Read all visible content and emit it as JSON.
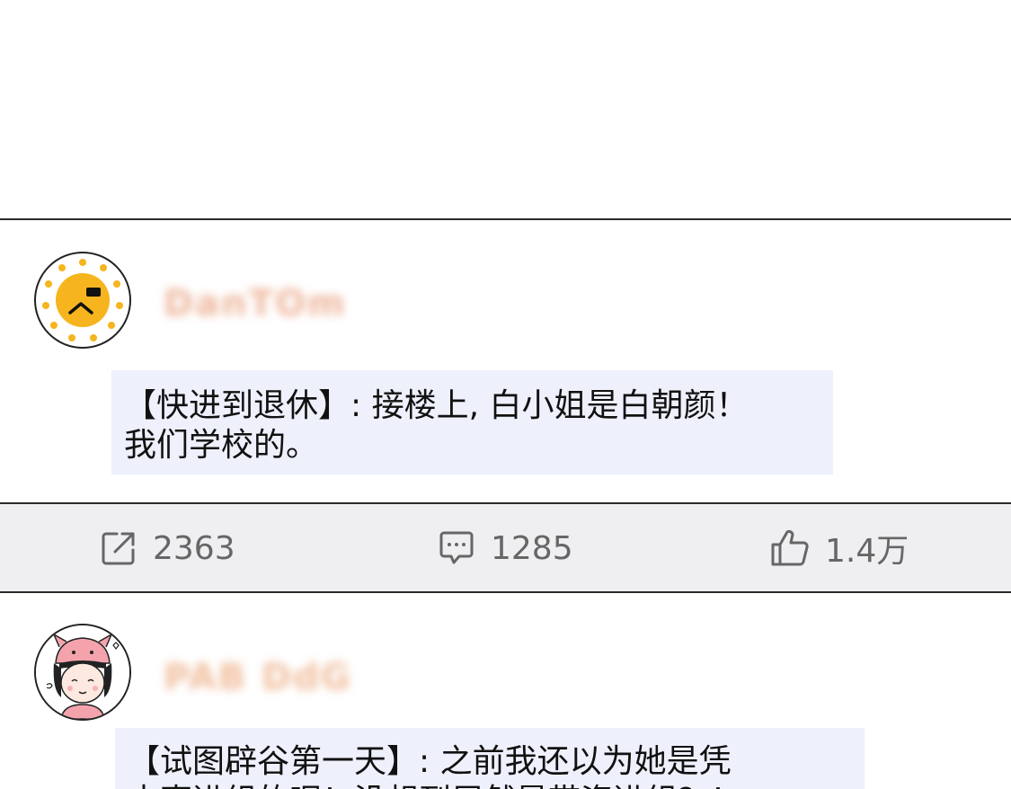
{
  "post1": {
    "username_blurred": "DanTOm",
    "comment_tag": "【快进到退休】",
    "comment_text": "接楼上, 白小姐是白朝颜！我们学校的。",
    "comment_line1": "【快进到退休】: 接楼上, 白小姐是白朝颜！",
    "comment_line2": "我们学校的。"
  },
  "actions": {
    "share_count": "2363",
    "comment_count": "1285",
    "like_count": "1.4万",
    "share_icon": "share-icon",
    "comment_icon": "comment-icon",
    "like_icon": "thumbs-up-icon"
  },
  "post2": {
    "username_blurred": "PAB DdG",
    "comment_line1": "【试图辟谷第一天】: 之前我还以为她是凭",
    "comment_line2": "本事进组的呢！没想到居然是带资进组？！"
  },
  "colors": {
    "comment_bg": "#eef0fb",
    "actions_bg": "#efeff1",
    "icon_gray": "#666666",
    "avatar1_yellow": "#f6b51e"
  }
}
